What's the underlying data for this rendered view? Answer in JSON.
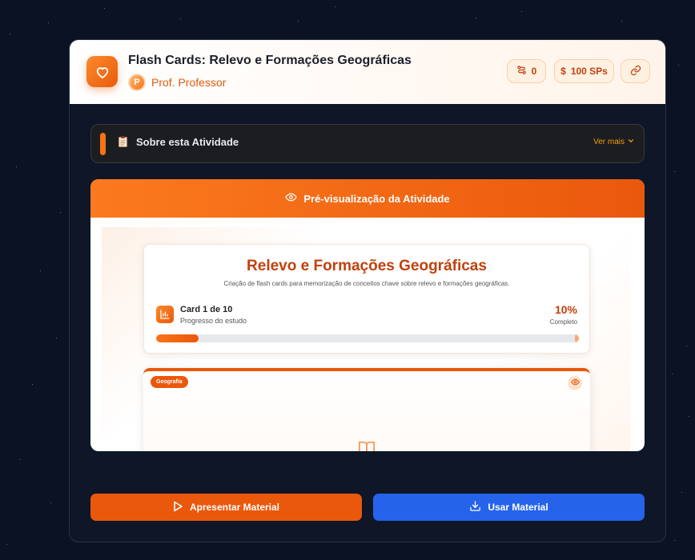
{
  "header": {
    "title": "Flash Cards: Relevo e Formações Geográficas",
    "author_initial": "P",
    "author_name": "Prof. Professor",
    "remix_count": "0",
    "price": "100 SPs",
    "price_symbol": "$"
  },
  "about": {
    "label": "Sobre esta Atividade",
    "more": "Ver mais"
  },
  "preview": {
    "header": "Pré-visualização da Atividade",
    "title": "Relevo e Formações Geográficas",
    "subtitle": "Criação de flash cards para memorização de conceitos chave sobre relevo e formações geográficas.",
    "progress_label": "Card 1 de 10",
    "progress_sub": "Progresso do estudo",
    "progress_percent_text": "10%",
    "progress_percent_label": "Completo",
    "progress_value": 0.1,
    "card_tag": "Geografia"
  },
  "actions": {
    "present": "Apresentar Material",
    "use": "Usar Material"
  },
  "colors": {
    "accent": "#ea580c",
    "primary_blue": "#2563eb",
    "background": "#0a1224"
  },
  "icons": {
    "app": "heart-icon",
    "remix": "remix-icon",
    "link": "link-icon",
    "about": "clipboard-icon",
    "preview": "eye-icon",
    "progress": "bar-chart-icon",
    "card": "book-icon",
    "present": "play-icon",
    "use": "download-icon"
  }
}
